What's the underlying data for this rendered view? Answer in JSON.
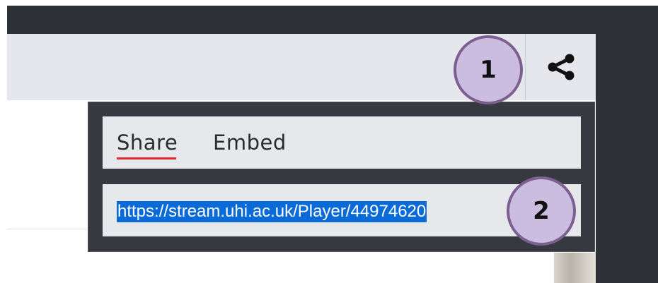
{
  "player": {
    "share_icon": "share-icon",
    "share_panel": {
      "tabs": [
        {
          "label": "Share",
          "active": true
        },
        {
          "label": "Embed",
          "active": false
        }
      ],
      "url_value": "https://stream.uhi.ac.uk/Player/44974620",
      "url_selected": true
    }
  },
  "annotations": [
    {
      "label": "1"
    },
    {
      "label": "2"
    }
  ],
  "colors": {
    "toolbar_bg": "#e5e7ec",
    "panel_bg": "#363a40",
    "active_tab_underline": "#e2262b",
    "selection_bg": "#0a6ad8",
    "badge_fill": "#cbbde0",
    "badge_border": "#7d5f92"
  }
}
